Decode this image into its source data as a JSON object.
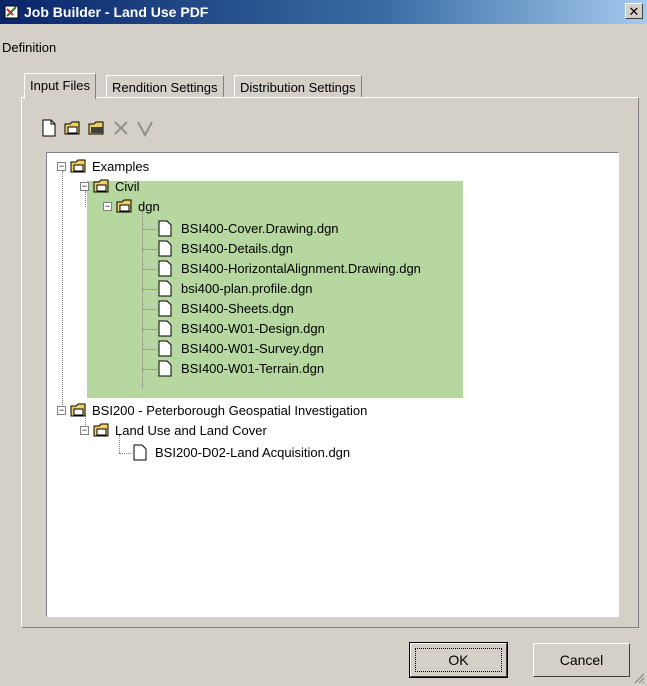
{
  "window": {
    "title": "Job Builder - Land Use PDF",
    "close": "✕"
  },
  "menu": {
    "definition": "Definition"
  },
  "tabs": [
    {
      "label": "Input Files"
    },
    {
      "label": "Rendition Settings"
    },
    {
      "label": "Distribution Settings"
    }
  ],
  "toolbar": {
    "icons": [
      "new-file-icon",
      "open-folder-icon",
      "print-icon",
      "delete-icon",
      "validate-icon"
    ]
  },
  "tree": {
    "examples": "Examples",
    "civil": "Civil",
    "dgn": "dgn",
    "civil_files": [
      "BSI400-Cover.Drawing.dgn",
      "BSI400-Details.dgn",
      "BSI400-HorizontalAlignment.Drawing.dgn",
      "bsi400-plan.profile.dgn",
      "BSI400-Sheets.dgn",
      "BSI400-W01-Design.dgn",
      "BSI400-W01-Survey.dgn",
      "BSI400-W01-Terrain.dgn"
    ],
    "bsi200": "BSI200 - Peterborough Geospatial Investigation",
    "landuse": "Land Use and Land Cover",
    "landuse_files": [
      "BSI200-D02-Land Acquisition.dgn"
    ],
    "expander_collapsed": "−"
  },
  "buttons": {
    "ok": "OK",
    "cancel": "Cancel"
  },
  "colors": {
    "titlebar": "#0a246a",
    "highlight": "#b7d7a0",
    "dialog": "#d4d0c8"
  }
}
